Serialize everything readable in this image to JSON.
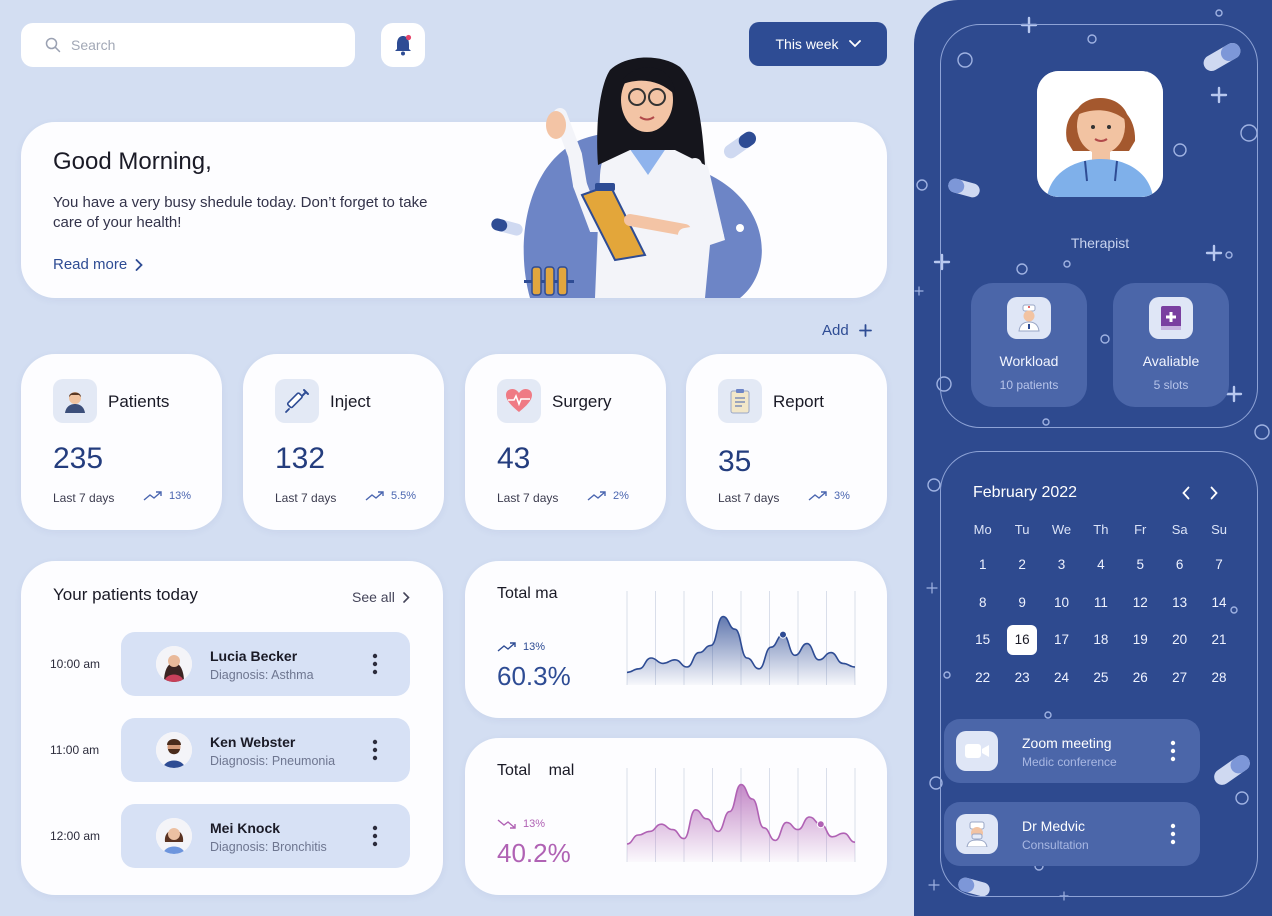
{
  "search": {
    "placeholder": "Search",
    "value": ""
  },
  "period_button": {
    "label": "This week"
  },
  "greeting": {
    "title": "Good Morning,",
    "message": "You have a very busy shedule today. Don’t forget to take care of your health!",
    "read_more": "Read more"
  },
  "add_label": "Add",
  "stats": [
    {
      "label": "Patients",
      "value": "235",
      "period": "Last 7 days",
      "trend": "13%",
      "icon": "patient-icon"
    },
    {
      "label": "Inject",
      "value": "132",
      "period": "Last 7 days",
      "trend": "5.5%",
      "icon": "syringe-icon"
    },
    {
      "label": "Surgery",
      "value": "43",
      "period": "Last 7 days",
      "trend": "2%",
      "icon": "heart-pulse-icon"
    },
    {
      "label": "Report",
      "value": "35",
      "period": "Last 7 days",
      "trend": "3%",
      "icon": "report-icon"
    }
  ],
  "patients_today": {
    "title": "Your patients today",
    "see_all": "See all",
    "rows": [
      {
        "time": "10:00 am",
        "name": "Lucia Becker",
        "diagnosis": "Diagnosis: Asthma"
      },
      {
        "time": "11:00 am",
        "name": "Ken Webster",
        "diagnosis": "Diagnosis: Pneumonia"
      },
      {
        "time": "12:00 am",
        "name": "Mei Knock",
        "diagnosis": "Diagnosis: Bronchitis"
      }
    ]
  },
  "charts": [
    {
      "title": "Total ma",
      "trend": "13%",
      "value": "60.3%",
      "color": "#2e4c94"
    },
    {
      "title": "Total    mal",
      "trend": "13%",
      "value": "40.2%",
      "color": "#b062b4"
    }
  ],
  "chart_data": [
    {
      "type": "area",
      "title": "Total ma",
      "values": [
        14,
        18,
        30,
        24,
        28,
        20,
        36,
        44,
        76,
        62,
        30,
        18,
        42,
        56,
        33,
        46,
        28,
        36,
        24,
        20
      ],
      "highlight_index": 13,
      "ylim": [
        0,
        100
      ]
    },
    {
      "type": "area",
      "title": "Total    mal",
      "values": [
        20,
        30,
        34,
        42,
        36,
        26,
        58,
        48,
        34,
        56,
        86,
        70,
        38,
        24,
        44,
        36,
        50,
        42,
        28,
        32,
        22
      ],
      "highlight_index": 17,
      "ylim": [
        0,
        100
      ]
    }
  ],
  "profile": {
    "role": "Therapist",
    "workload": {
      "title": "Workload",
      "sub": "10 patients"
    },
    "available": {
      "title": "Avaliable",
      "sub": "5 slots"
    }
  },
  "calendar": {
    "month": "February 2022",
    "weekdays": [
      "Mo",
      "Tu",
      "We",
      "Th",
      "Fr",
      "Sa",
      "Su"
    ],
    "days": [
      "1",
      "2",
      "3",
      "4",
      "5",
      "6",
      "7",
      "8",
      "9",
      "10",
      "11",
      "12",
      "13",
      "14",
      "15",
      "16",
      "17",
      "18",
      "19",
      "20",
      "21",
      "22",
      "23",
      "24",
      "25",
      "26",
      "27",
      "28"
    ],
    "selected": "16"
  },
  "events": [
    {
      "title": "Zoom meeting",
      "sub": "Medic conference",
      "icon": "video-camera-icon"
    },
    {
      "title": "Dr Medvic",
      "sub": "Consultation",
      "icon": "doctor-icon"
    }
  ],
  "colors": {
    "accent": "#2e4c94",
    "background": "#d3def2",
    "panel": "#2e4a8f",
    "pink": "#b062b4"
  }
}
